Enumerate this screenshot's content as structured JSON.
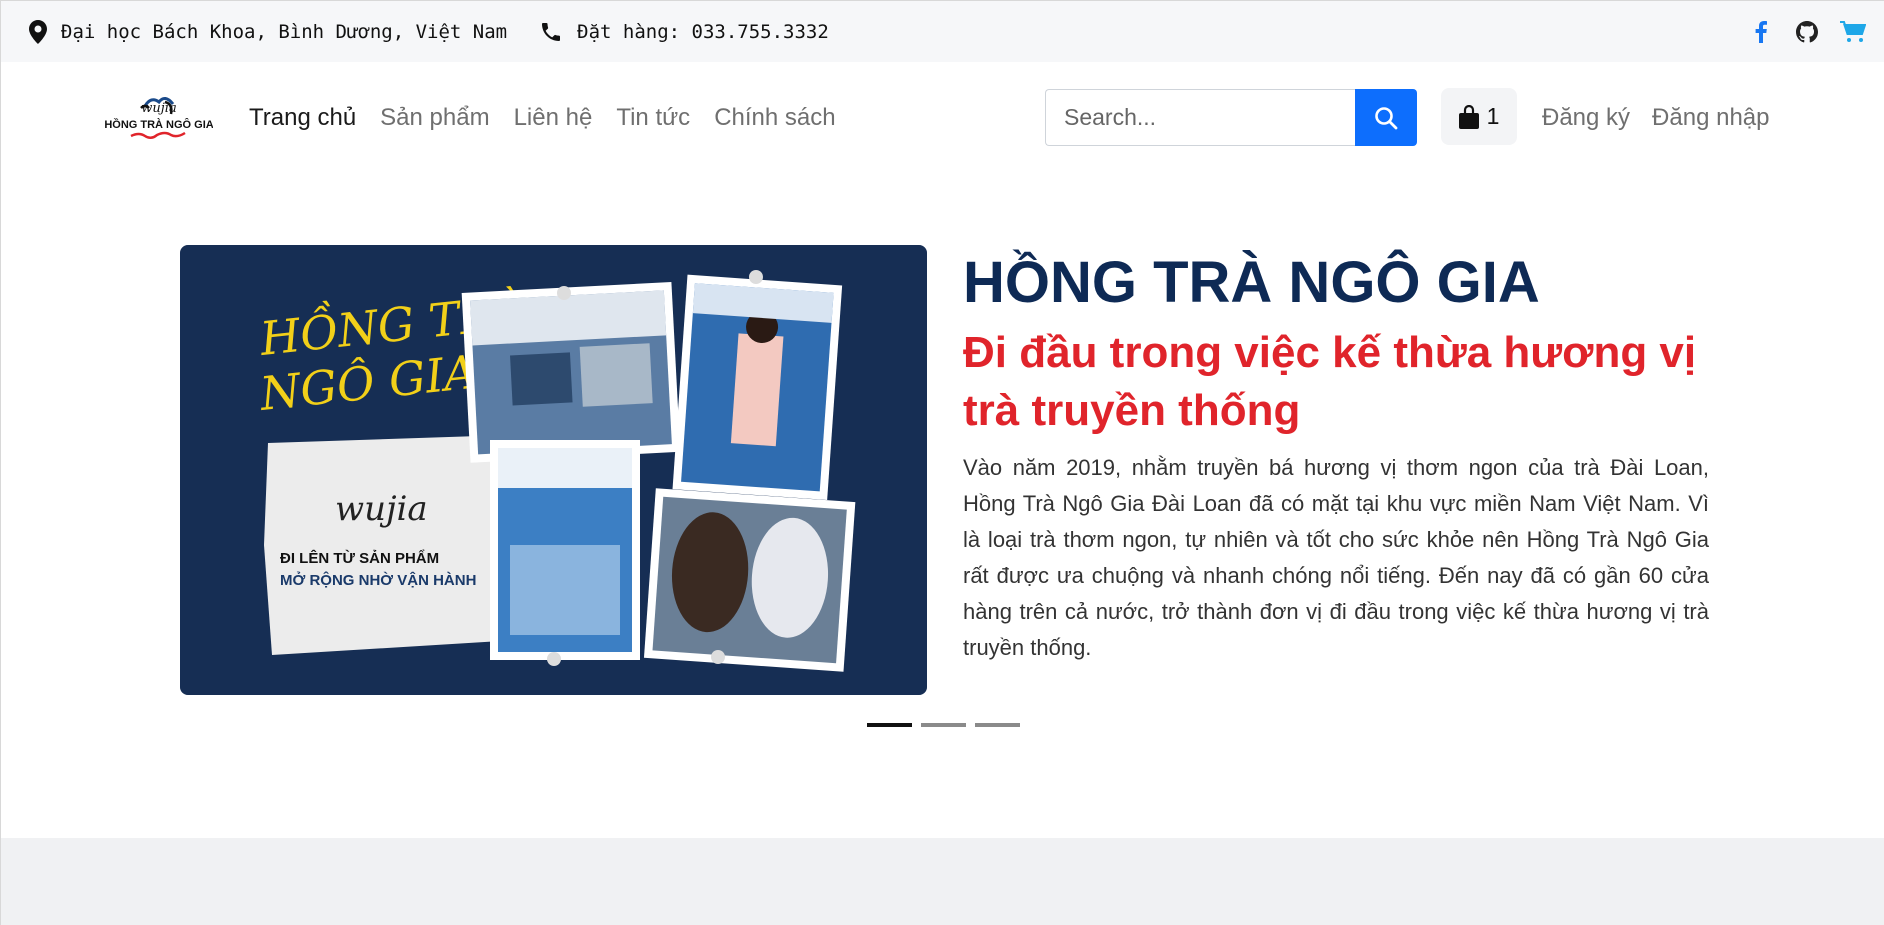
{
  "topbar": {
    "address": "Đại học Bách Khoa, Bình Dương, Việt Nam",
    "phone": "Đặt hàng: 033.755.3332",
    "social_icons": [
      "facebook-icon",
      "github-icon",
      "cart-icon"
    ]
  },
  "navbar": {
    "logo": {
      "text": "HỒNG TRÀ NGÔ GIA",
      "brand": "wujia"
    },
    "links": [
      "Trang chủ",
      "Sản phẩm",
      "Liên hệ",
      "Tin tức",
      "Chính sách"
    ],
    "search_placeholder": "Search...",
    "cart_count": "1",
    "register": "Đăng ký",
    "login": "Đăng nhập"
  },
  "hero": {
    "title": "HỒNG TRÀ NGÔ GIA",
    "subtitle": "Đi đầu trong việc kế thừa hương vị trà truyền thống",
    "description": "Vào năm 2019, nhằm truyền bá hương vị thơm ngon của trà Đài Loan, Hồng Trà Ngô Gia Đài Loan đã có mặt tại khu vực miền Nam Việt Nam. Vì là loại trà thơm ngon, tự nhiên và tốt cho sức khỏe nên Hồng Trà Ngô Gia rất được ưa chuộng và nhanh chóng nổi tiếng. Đến nay đã có gần 60 cửa hàng trên cả nước, trở thành đơn vị đi đầu trong việc kế thừa hương vị trà truyền thống.",
    "banner": {
      "script_title_1": "HỒNG TRÀ",
      "script_title_2": "NGÔ GIA",
      "brand": "wujia",
      "slogan_1": "ĐI LÊN TỪ SẢN PHẨM",
      "slogan_2": "MỞ RỘNG NHỜ VẬN HÀNH"
    },
    "slides": 3,
    "active_slide": 1
  },
  "colors": {
    "accent": "#0d6efd",
    "title": "#0e2a55",
    "subtitle": "#e0242b",
    "facebook": "#1877f2",
    "cart": "#1ea7e8"
  }
}
